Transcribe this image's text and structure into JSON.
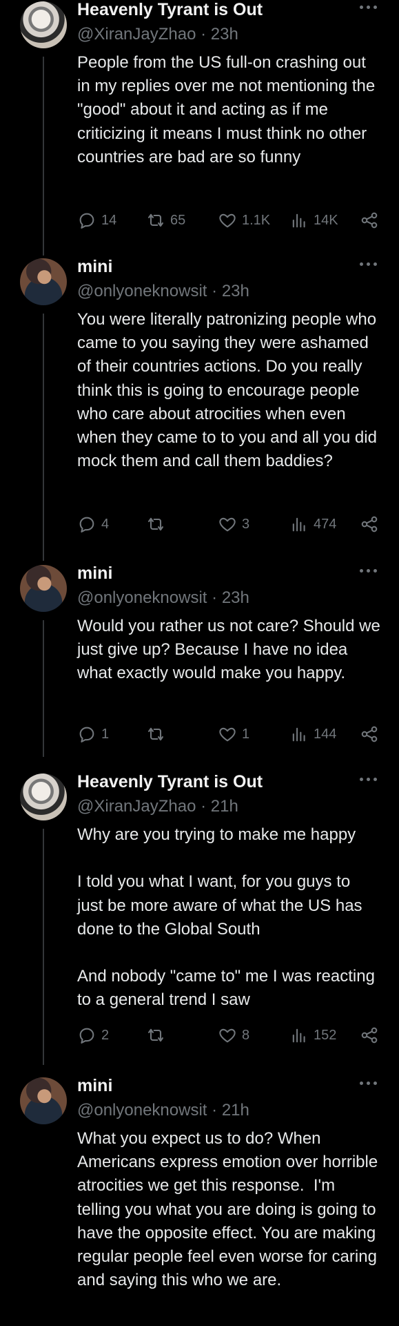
{
  "thread": [
    {
      "author": "Heavenly Tyrant is Out",
      "handle": "@XiranJayZhao",
      "time": "23h",
      "text": "People from the US full-on crashing out in my replies over me not mentioning the \"good\" about it and acting as if me criticizing it means I must think no other countries are bad are so funny",
      "replies": "14",
      "retweets": "65",
      "likes": "1.1K",
      "views": "14K"
    },
    {
      "author": "mini",
      "handle": "@onlyoneknowsit",
      "time": "23h",
      "text": "You were literally patronizing people who came to you saying they were ashamed of their countries actions. Do you really think this is going to encourage people who care about atrocities when even when they came to to you and all you did mock them and call them baddies?",
      "replies": "4",
      "retweets": "",
      "likes": "3",
      "views": "474"
    },
    {
      "author": "mini",
      "handle": "@onlyoneknowsit",
      "time": "23h",
      "text": "Would you rather us not care? Should we just give up? Because I have no idea what exactly would make you happy.",
      "replies": "1",
      "retweets": "",
      "likes": "1",
      "views": "144"
    },
    {
      "author": "Heavenly Tyrant is Out",
      "handle": "@XiranJayZhao",
      "time": "21h",
      "text": "Why are you trying to make me happy\n\nI told you what I want, for you guys to just be more aware of what the US has done to the Global South\n\nAnd nobody \"came to\" me I was reacting to a general trend I saw",
      "replies": "2",
      "retweets": "",
      "likes": "8",
      "views": "152"
    },
    {
      "author": "mini",
      "handle": "@onlyoneknowsit",
      "time": "21h",
      "text": "What you expect us to do? When Americans express emotion over horrible atrocities we get this response.  I'm telling you what you are doing is going to have the opposite effect. You are making regular people feel even worse for caring and saying this who we are.",
      "replies": "",
      "retweets": "",
      "likes": "",
      "views": ""
    }
  ],
  "separator": "·",
  "colors": {
    "background": "#000000",
    "text": "#e7e9ea",
    "muted": "#71767b",
    "thread_line": "#333639"
  },
  "icons": {
    "more": "more-horizontal-icon",
    "reply": "reply-icon",
    "retweet": "retweet-icon",
    "like": "heart-icon",
    "views": "analytics-icon",
    "share": "share-icon"
  }
}
